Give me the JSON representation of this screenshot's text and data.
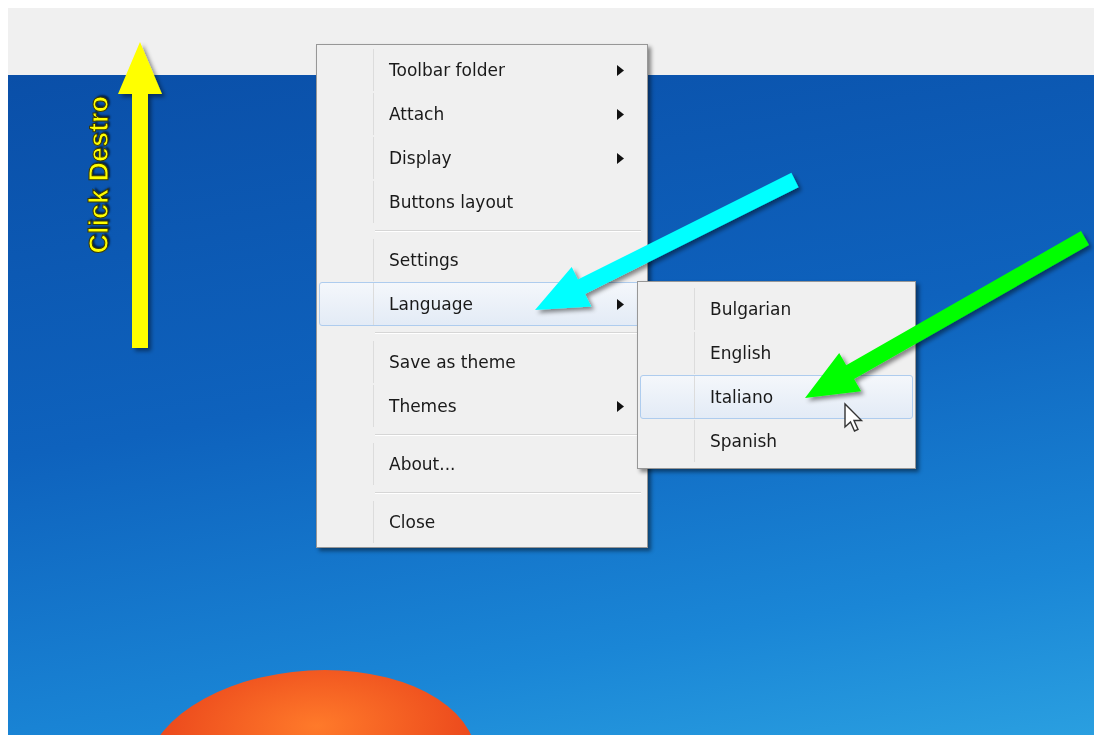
{
  "menu": {
    "items": [
      {
        "kind": "item",
        "label": "Toolbar folder",
        "has_submenu": true,
        "selected": false
      },
      {
        "kind": "item",
        "label": "Attach",
        "has_submenu": true,
        "selected": false
      },
      {
        "kind": "item",
        "label": "Display",
        "has_submenu": true,
        "selected": false
      },
      {
        "kind": "item",
        "label": "Buttons layout",
        "has_submenu": false,
        "selected": false
      },
      {
        "kind": "separator"
      },
      {
        "kind": "item",
        "label": "Settings",
        "has_submenu": false,
        "selected": false
      },
      {
        "kind": "item",
        "label": "Language",
        "has_submenu": true,
        "selected": true
      },
      {
        "kind": "separator"
      },
      {
        "kind": "item",
        "label": "Save as theme",
        "has_submenu": false,
        "selected": false
      },
      {
        "kind": "item",
        "label": "Themes",
        "has_submenu": true,
        "selected": false
      },
      {
        "kind": "separator"
      },
      {
        "kind": "item",
        "label": "About...",
        "has_submenu": false,
        "selected": false
      },
      {
        "kind": "separator"
      },
      {
        "kind": "item",
        "label": "Close",
        "has_submenu": false,
        "selected": false
      }
    ]
  },
  "submenu": {
    "items": [
      {
        "label": "Bulgarian",
        "selected": false
      },
      {
        "label": "English",
        "selected": false
      },
      {
        "label": "Italiano",
        "selected": true
      },
      {
        "label": "Spanish",
        "selected": false
      }
    ]
  },
  "annotations": [
    {
      "kind": "up",
      "color": "#ffff00",
      "label": "Click Destro"
    },
    {
      "kind": "cyan",
      "color": "#00ffff"
    },
    {
      "kind": "green",
      "color": "#00ff00"
    }
  ]
}
